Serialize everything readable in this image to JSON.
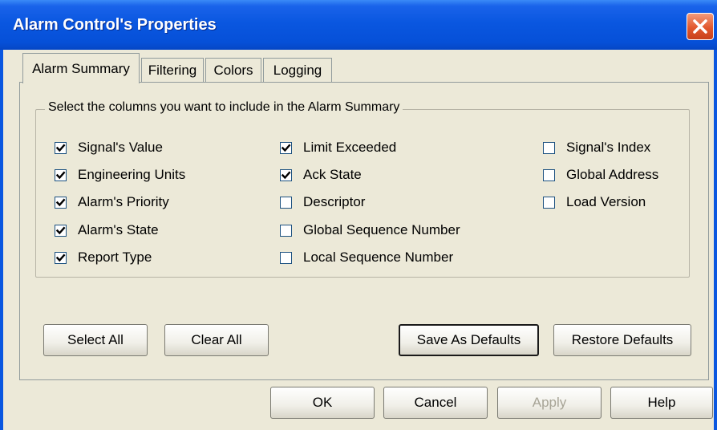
{
  "window": {
    "title": "Alarm Control's Properties"
  },
  "tabs": [
    {
      "label": "Alarm Summary",
      "active": true
    },
    {
      "label": "Filtering",
      "active": false
    },
    {
      "label": "Colors",
      "active": false
    },
    {
      "label": "Logging",
      "active": false
    }
  ],
  "group": {
    "legend": "Select the columns you want to include in the Alarm Summary"
  },
  "columns": [
    {
      "label": "Signal's Value",
      "checked": true
    },
    {
      "label": "Engineering Units",
      "checked": true
    },
    {
      "label": "Alarm's Priority",
      "checked": true
    },
    {
      "label": "Alarm's State",
      "checked": true
    },
    {
      "label": "Report Type",
      "checked": true
    },
    {
      "label": "Limit Exceeded",
      "checked": true
    },
    {
      "label": "Ack State",
      "checked": true
    },
    {
      "label": "Descriptor",
      "checked": false
    },
    {
      "label": "Global Sequence Number",
      "checked": false
    },
    {
      "label": "Local Sequence Number",
      "checked": false
    },
    {
      "label": "Signal's Index",
      "checked": false
    },
    {
      "label": "Global Address",
      "checked": false
    },
    {
      "label": "Load Version",
      "checked": false
    }
  ],
  "buttons": {
    "select_all": "Select All",
    "clear_all": "Clear All",
    "save_defaults": "Save As Defaults",
    "restore_defaults": "Restore Defaults",
    "ok": "OK",
    "cancel": "Cancel",
    "apply": "Apply",
    "help": "Help"
  },
  "icons": {
    "close": "close-icon",
    "check": "check-icon"
  },
  "colors": {
    "titlebar": "#0a57e0",
    "close_button": "#e2582e",
    "dialog_bg": "#ece9d8"
  }
}
